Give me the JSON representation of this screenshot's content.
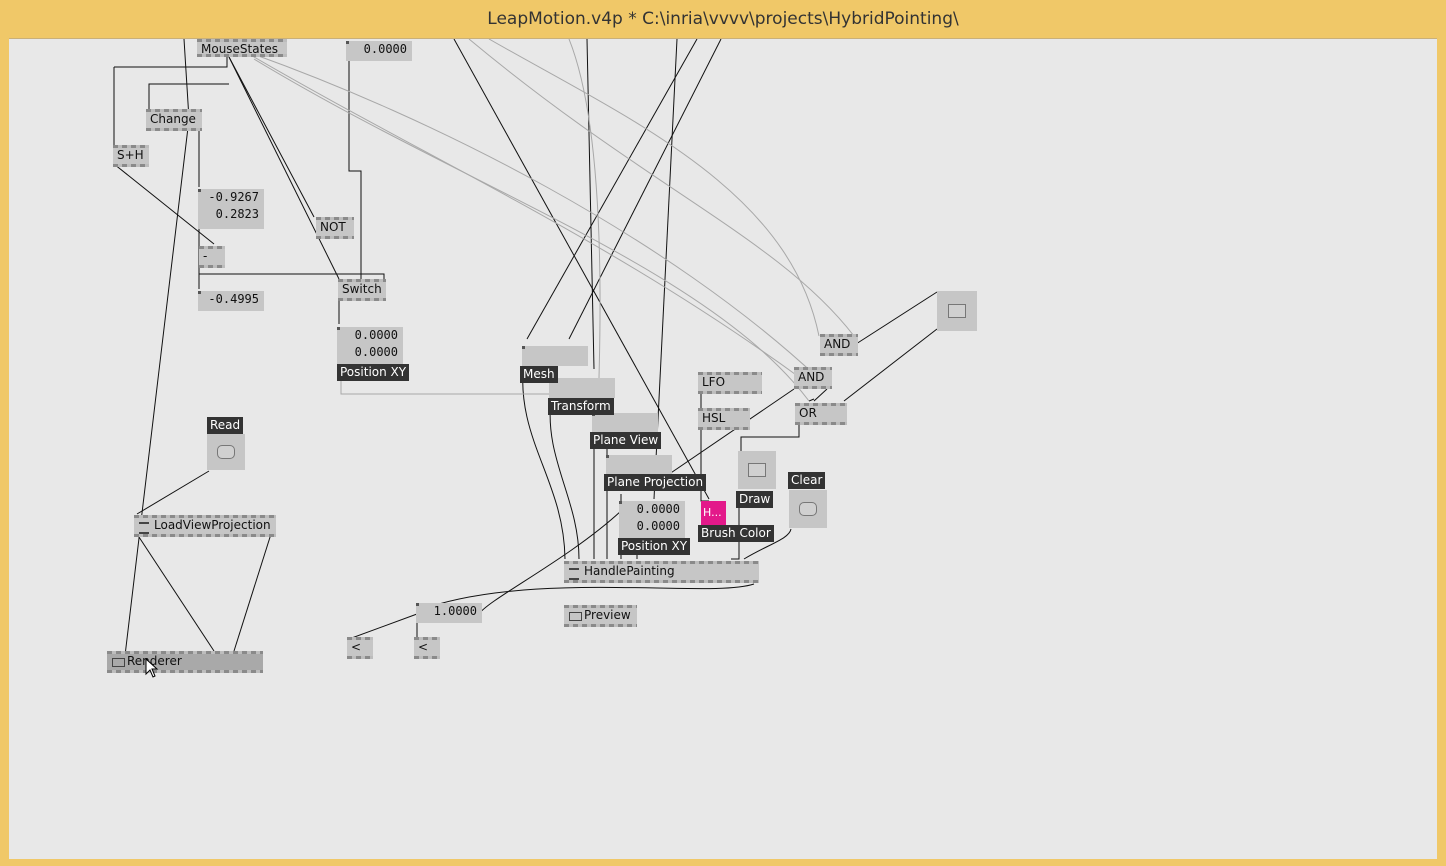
{
  "window": {
    "title": "LeapMotion.v4p *  C:\\inria\\vvvv\\projects\\HybridPointing\\"
  },
  "colors": {
    "frame": "#f0c868",
    "canvas": "#e8e8e8",
    "node": "#c6c6c6",
    "tag": "#333333",
    "color_node": "#e3198a"
  },
  "nodes": {
    "mousestates": "MouseStates",
    "change": "Change",
    "sh": "S+H",
    "not": "NOT",
    "minus": "-",
    "switch": "Switch",
    "and1": "AND",
    "and2": "AND",
    "or": "OR",
    "lfo": "LFO",
    "hsl": "HSL",
    "loadviewprojection": "LoadViewProjection",
    "renderer": "Renderer",
    "handlepainting": "HandlePainting",
    "preview": "Preview",
    "lt1": "<",
    "lt2": "<"
  },
  "ioboxes": {
    "top_value": "0.0000",
    "vec_a1": "-0.9267",
    "vec_a2": "0.2823",
    "minus_out": "-0.4995",
    "pos_xy_1a": "0.0000",
    "pos_xy_1b": "0.0000",
    "pos_xy_2a": "0.0000",
    "pos_xy_2b": "0.0000",
    "scale_value": "1.0000",
    "color_value": "H..."
  },
  "tags": {
    "position_xy_1": "Position XY",
    "read": "Read",
    "mesh": "Mesh",
    "transform": "Transform",
    "plane_view": "Plane View",
    "plane_projection": "Plane Projection",
    "position_xy_2": "Position XY",
    "brush_color": "Brush Color",
    "draw": "Draw",
    "clear": "Clear"
  }
}
